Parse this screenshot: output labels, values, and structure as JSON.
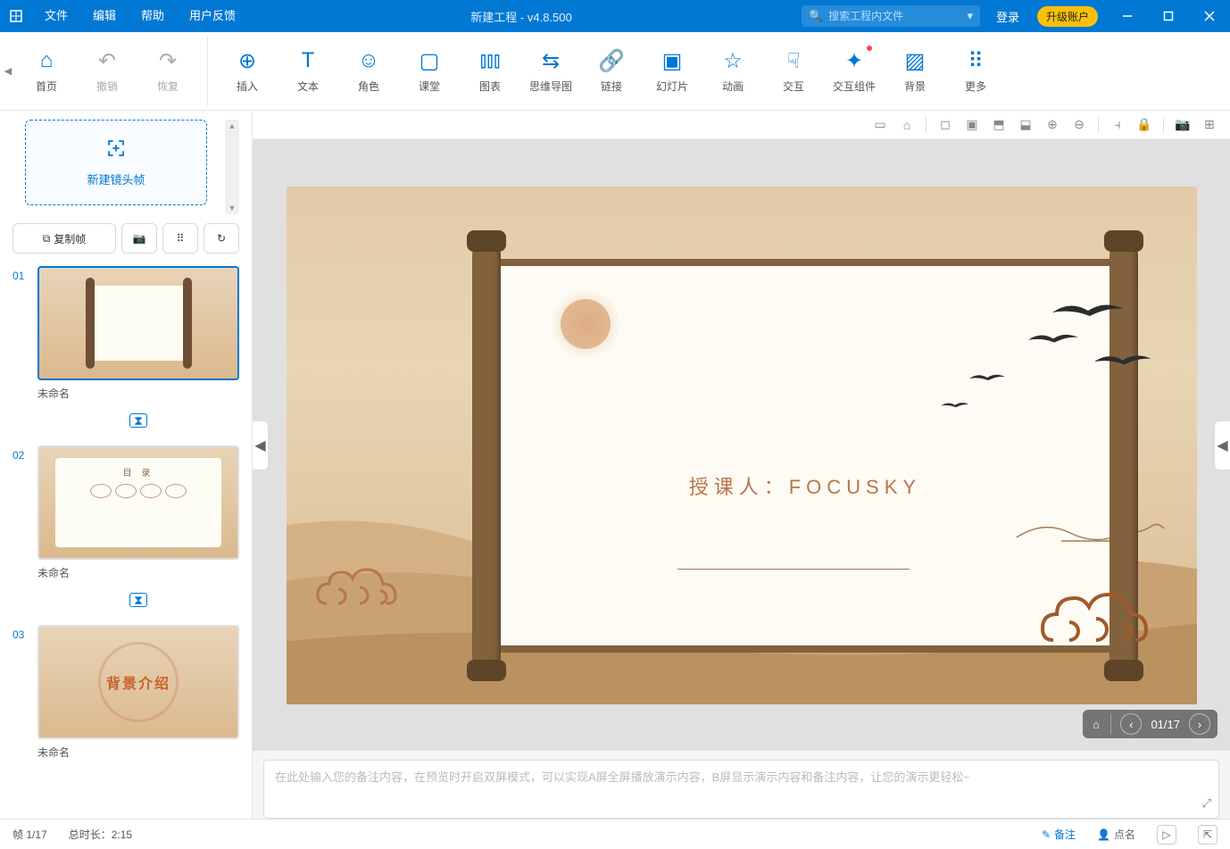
{
  "titleBar": {
    "menus": [
      "文件",
      "编辑",
      "帮助",
      "用户反馈"
    ],
    "title": "新建工程 - v4.8.500",
    "searchPlaceholder": "搜索工程内文件",
    "login": "登录",
    "upgrade": "升级账户"
  },
  "toolbar": {
    "groupA": [
      {
        "icon": "⌂",
        "label": "首页"
      },
      {
        "icon": "↶",
        "label": "撤销",
        "disabled": true
      },
      {
        "icon": "↷",
        "label": "恢复",
        "disabled": true
      }
    ],
    "groupB": [
      {
        "icon": "⊕",
        "label": "插入"
      },
      {
        "icon": "T",
        "label": "文本"
      },
      {
        "icon": "☺",
        "label": "角色"
      },
      {
        "icon": "▢",
        "label": "课堂"
      },
      {
        "icon": "⫾⫾⫾",
        "label": "图表"
      },
      {
        "icon": "⇆",
        "label": "思维导图"
      },
      {
        "icon": "🔗",
        "label": "链接"
      },
      {
        "icon": "▣",
        "label": "幻灯片"
      },
      {
        "icon": "☆",
        "label": "动画"
      },
      {
        "icon": "☟",
        "label": "交互"
      },
      {
        "icon": "✦",
        "label": "交互组件",
        "dot": true
      },
      {
        "icon": "▨",
        "label": "背景"
      },
      {
        "icon": "⠿",
        "label": "更多"
      }
    ]
  },
  "leftPanel": {
    "newFrame": "新建镜头帧",
    "copyFrame": "复制帧",
    "slides": [
      {
        "num": "01",
        "name": "未命名",
        "selected": true,
        "type": "scroll"
      },
      {
        "num": "02",
        "name": "未命名",
        "selected": false,
        "type": "toc",
        "tocTitle": "目 录"
      },
      {
        "num": "03",
        "name": "未命名",
        "selected": false,
        "type": "intro",
        "introText": "背景介绍"
      }
    ]
  },
  "canvas": {
    "mainText": "授课人：FOCUSKY",
    "frameCounter": "01/17"
  },
  "notes": {
    "placeholder": "在此处输入您的备注内容，在预览时开启双屏模式，可以实现A屏全屏播放演示内容，B屏显示演示内容和备注内容，让您的演示更轻松~"
  },
  "statusBar": {
    "frame": "帧 1/17",
    "totalTime": "总时长：2:15",
    "notes": "备注",
    "roll": "点名"
  }
}
